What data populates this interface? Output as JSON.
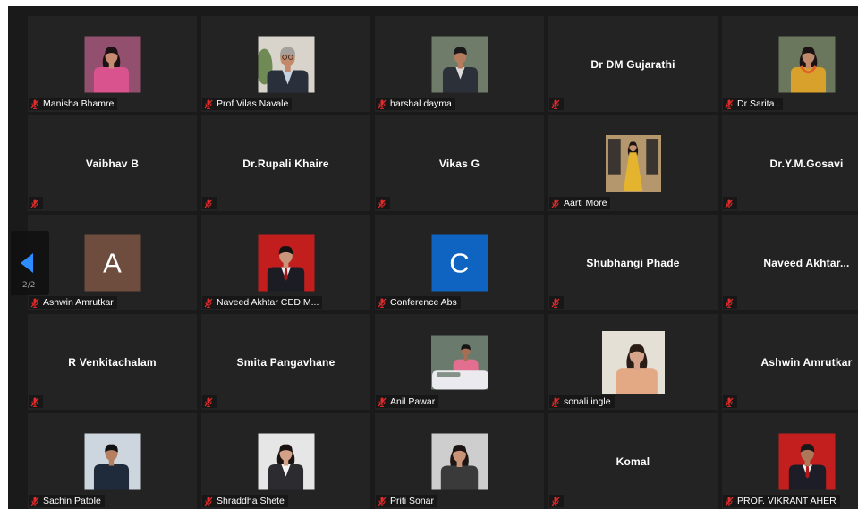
{
  "colors": {
    "panel": "#1a1a1a",
    "tile": "#232323",
    "muted_icon": "#e22b2b",
    "nav_arrow": "#2d8cff"
  },
  "icons": {
    "muted_mic": "mic-muted-icon",
    "previous_page": "arrow-left-icon"
  },
  "nav": {
    "page_indicator": "2/2"
  },
  "participants": [
    {
      "label": "Manisha Bhamre",
      "photo": {
        "bg": "#93506e",
        "skin": "#c68b70",
        "hair": "#1c1214",
        "outfit": "#d9548f"
      }
    },
    {
      "label": "Prof Vilas Navale",
      "photo": {
        "bg": "#d8d4cb",
        "skin": "#c28a6b",
        "hair": "#a4a19c",
        "outfit": "#2a2f3c",
        "shirt": "#c6d2e2",
        "accent": "#6f8a55"
      }
    },
    {
      "label": "harshal dayma",
      "photo": {
        "bg": "#6f7c69",
        "skin": "#b47c5e",
        "hair": "#191919",
        "outfit": "#2c3038",
        "shirt": "#dcdcdc"
      }
    },
    {
      "name": "Dr DM Gujarathi"
    },
    {
      "label": "Dr Sarita .",
      "photo": {
        "bg": "#6b775c",
        "skin": "#bf8a6b",
        "hair": "#1a1213",
        "outfit": "#d8a12c",
        "accent": "#e0642a"
      }
    },
    {
      "name": "Vaibhav B"
    },
    {
      "name": "Dr.Rupali Khaire"
    },
    {
      "name": "Vikas G"
    },
    {
      "label": "Aarti More",
      "photo": {
        "bg": "#b4976c",
        "skin": "#c4906f",
        "hair": "#1b1414",
        "outfit": "#e4b42f",
        "accent": "#3a3530"
      }
    },
    {
      "name": "Dr.Y.M.Gosavi"
    },
    {
      "label": "Ashwin Amrutkar",
      "initial": "A",
      "avatar_color": "#6e4d3f"
    },
    {
      "label": "Naveed Akhtar CED M...",
      "photo": {
        "bg": "#c21e1e",
        "skin": "#c9957a",
        "hair": "#121212",
        "outfit": "#1c1c24",
        "shirt": "#ededed",
        "accent": "#a51616"
      }
    },
    {
      "label": "Conference Abs",
      "initial": "C",
      "avatar_color": "#0e64c0"
    },
    {
      "name": "Shubhangi Phade"
    },
    {
      "name": "Naveed Akhtar..."
    },
    {
      "name": "R Venkitachalam"
    },
    {
      "name": "Smita Pangavhane"
    },
    {
      "label": "Anil Pawar",
      "photo": {
        "bg": "#6a7a6c",
        "skin": "#a66e52",
        "hair": "#141414",
        "outfit": "#e36f90",
        "accent": "#ebebef"
      }
    },
    {
      "label": "sonali ingle",
      "photo": {
        "bg": "#e5e0d6",
        "skin": "#d5a48a",
        "hair": "#2a1d17",
        "outfit": "#e3a985"
      }
    },
    {
      "name": "Ashwin Amrutkar"
    },
    {
      "label": "Sachin Patole",
      "photo": {
        "bg": "#cdd5de",
        "skin": "#b58062",
        "hair": "#121212",
        "outfit": "#1f2a3b"
      }
    },
    {
      "label": "Shraddha Shete",
      "photo": {
        "bg": "#e6e6e6",
        "skin": "#d2a187",
        "hair": "#1b1311",
        "outfit": "#2b2b30",
        "shirt": "#f3f3f3"
      }
    },
    {
      "label": "Priti Sonar",
      "photo": {
        "bg": "#cecece",
        "skin": "#c99378",
        "hair": "#1d1513",
        "outfit": "#3a3a3a"
      }
    },
    {
      "name": "Komal"
    },
    {
      "label": "PROF. VIKRANT AHER",
      "photo": {
        "bg": "#c41f1f",
        "skin": "#ad785a",
        "hair": "#181818",
        "outfit": "#1d1d28",
        "shirt": "#f1f1f1",
        "accent": "#b31717"
      }
    }
  ]
}
